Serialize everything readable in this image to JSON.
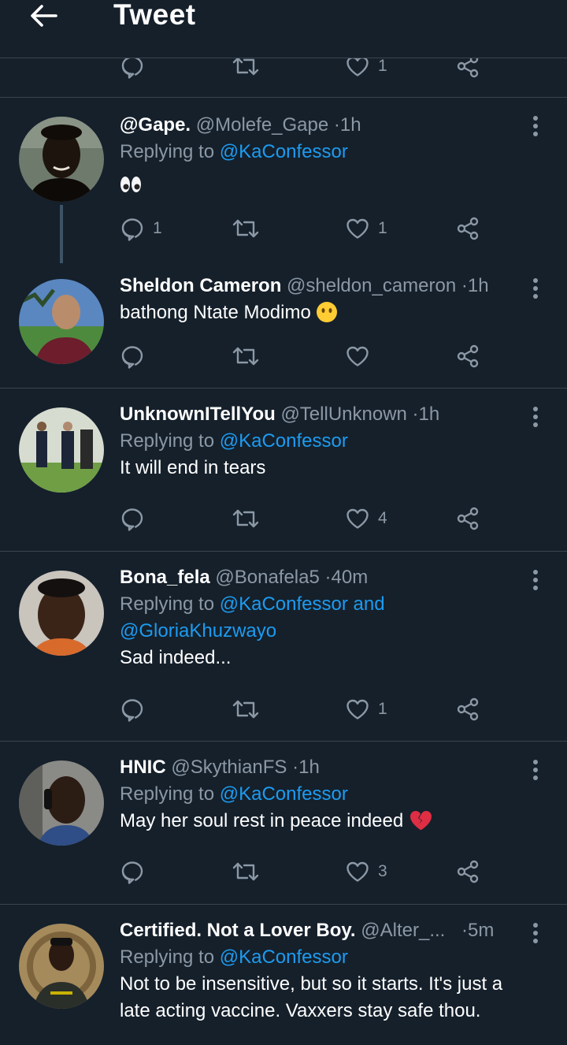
{
  "header": {
    "title": "Tweet"
  },
  "icons": {
    "back": "arrow-left-icon",
    "reply": "comment-icon",
    "retweet": "retweet-icon",
    "like": "heart-icon",
    "share": "share-icon",
    "more": "more-vertical-icon"
  },
  "colors": {
    "background": "#15202b",
    "accent": "#1d9bf0",
    "muted": "#8b98a5",
    "divider": "#38444d",
    "heart": "#e0245e"
  },
  "partial_tweet": {
    "like_count": "1"
  },
  "tweets": [
    {
      "name": "@Gape.",
      "handle": "@Molefe_Gape",
      "time": "1h",
      "replying_to": "@KaConfessor",
      "text": "",
      "emoji": "eyes",
      "reply_count": "1",
      "like_count": "1"
    },
    {
      "name": "Sheldon Cameron",
      "handle": "@sheldon_cameron",
      "time": "1h",
      "text": "bathong Ntate Modimo",
      "emoji": "no-mouth-face"
    },
    {
      "name": "UnknownITellYou",
      "handle": "@TellUnknown",
      "time": "1h",
      "replying_to": "@KaConfessor",
      "text": "It will end in tears",
      "like_count": "4"
    },
    {
      "name": "Bona_fela",
      "handle": "@Bonafela5",
      "time": "40m",
      "replying_to": "@KaConfessor and",
      "replying_to_2": "@GloriaKhuzwayo",
      "text": "Sad indeed...",
      "like_count": "1"
    },
    {
      "name": "HNIC",
      "handle": "@SkythianFS",
      "time": "1h",
      "replying_to": "@KaConfessor",
      "text": "May her soul rest in peace indeed",
      "emoji": "broken-heart",
      "like_count": "3"
    },
    {
      "name": "Certified. Not a Lover Boy.",
      "handle": "@Alter_...",
      "time": "5m",
      "replying_to": "@KaConfessor",
      "text_line1": "Not to be insensitive, but so it starts. It's just a",
      "text_line2": "late acting vaccine. Vaxxers stay safe thou."
    }
  ],
  "labels": {
    "replying_prefix": "Replying to",
    "dot": "·"
  }
}
